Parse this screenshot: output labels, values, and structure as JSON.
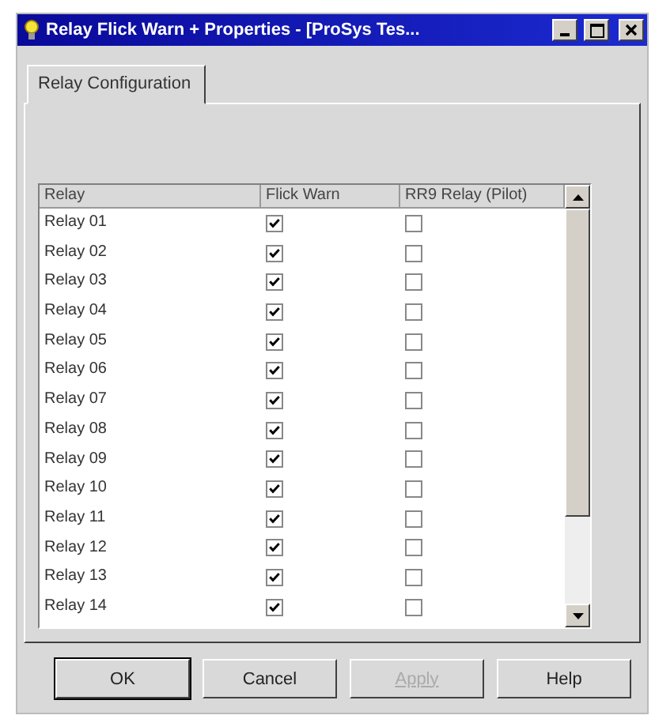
{
  "window": {
    "title": "Relay Flick Warn + Properties - [ProSys Tes..."
  },
  "tabs": [
    {
      "label": "Relay Configuration",
      "selected": true
    }
  ],
  "table": {
    "columns": [
      "Relay",
      "Flick Warn",
      "RR9 Relay (Pilot)"
    ],
    "rows": [
      {
        "relay": "Relay 01",
        "flick_warn": true,
        "rr9_relay": false
      },
      {
        "relay": "Relay 02",
        "flick_warn": true,
        "rr9_relay": false
      },
      {
        "relay": "Relay 03",
        "flick_warn": true,
        "rr9_relay": false
      },
      {
        "relay": "Relay 04",
        "flick_warn": true,
        "rr9_relay": false
      },
      {
        "relay": "Relay 05",
        "flick_warn": true,
        "rr9_relay": false
      },
      {
        "relay": "Relay 06",
        "flick_warn": true,
        "rr9_relay": false
      },
      {
        "relay": "Relay 07",
        "flick_warn": true,
        "rr9_relay": false
      },
      {
        "relay": "Relay 08",
        "flick_warn": true,
        "rr9_relay": false
      },
      {
        "relay": "Relay 09",
        "flick_warn": true,
        "rr9_relay": false
      },
      {
        "relay": "Relay 10",
        "flick_warn": true,
        "rr9_relay": false
      },
      {
        "relay": "Relay 11",
        "flick_warn": true,
        "rr9_relay": false
      },
      {
        "relay": "Relay 12",
        "flick_warn": true,
        "rr9_relay": false
      },
      {
        "relay": "Relay 13",
        "flick_warn": true,
        "rr9_relay": false
      },
      {
        "relay": "Relay 14",
        "flick_warn": true,
        "rr9_relay": false
      }
    ]
  },
  "buttons": [
    {
      "label": "OK",
      "disabled": false,
      "default": true
    },
    {
      "label": "Cancel",
      "disabled": false,
      "default": false
    },
    {
      "label": "Apply",
      "disabled": true,
      "default": false
    },
    {
      "label": "Help",
      "disabled": false,
      "default": false
    }
  ]
}
